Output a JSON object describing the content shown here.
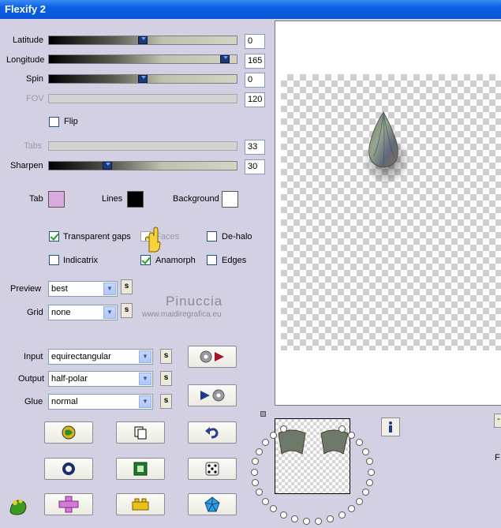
{
  "window": {
    "title": "Flexify 2"
  },
  "sliders": {
    "latitude": {
      "label": "Latitude",
      "value": "0",
      "fraction": 0.5
    },
    "longitude": {
      "label": "Longitude",
      "value": "165",
      "fraction": 0.96
    },
    "spin": {
      "label": "Spin",
      "value": "0",
      "fraction": 0.5
    },
    "fov": {
      "label": "FOV",
      "value": "120",
      "fraction": 0.0
    },
    "tabs": {
      "label": "Tabs",
      "value": "33",
      "fraction": 0.0
    },
    "sharpen": {
      "label": "Sharpen",
      "value": "30",
      "fraction": 0.3
    }
  },
  "checkboxes": {
    "flip": {
      "label": "Flip",
      "checked": false
    },
    "transparent_gaps": {
      "label": "Transparent gaps",
      "checked": true
    },
    "faces": {
      "label": "Faces",
      "checked": false
    },
    "de_halo": {
      "label": "De-halo",
      "checked": false
    },
    "indicatrix": {
      "label": "Indicatrix",
      "checked": false
    },
    "anamorph": {
      "label": "Anamorph",
      "checked": true
    },
    "edges": {
      "label": "Edges",
      "checked": false
    }
  },
  "colors": {
    "tab": {
      "label": "Tab",
      "value": "#d9a8dc"
    },
    "lines": {
      "label": "Lines",
      "value": "#000000"
    },
    "background": {
      "label": "Background",
      "value": "#ffffff"
    }
  },
  "selects": {
    "preview": {
      "label": "Preview",
      "value": "best"
    },
    "grid": {
      "label": "Grid",
      "value": "none"
    },
    "input": {
      "label": "Input",
      "value": "equirectangular"
    },
    "output": {
      "label": "Output",
      "value": "half-polar"
    },
    "glue": {
      "label": "Glue",
      "value": "normal"
    }
  },
  "small_button_label": "s",
  "watermark": {
    "name": "Pinuccia",
    "url": "www.maidiregrafica.eu"
  },
  "right_panel": {
    "minus_label": "-",
    "f_label": "F"
  },
  "icons": {
    "play_forward": "record-play-icon",
    "play_back": "play-record-icon",
    "info": "info-icon"
  }
}
